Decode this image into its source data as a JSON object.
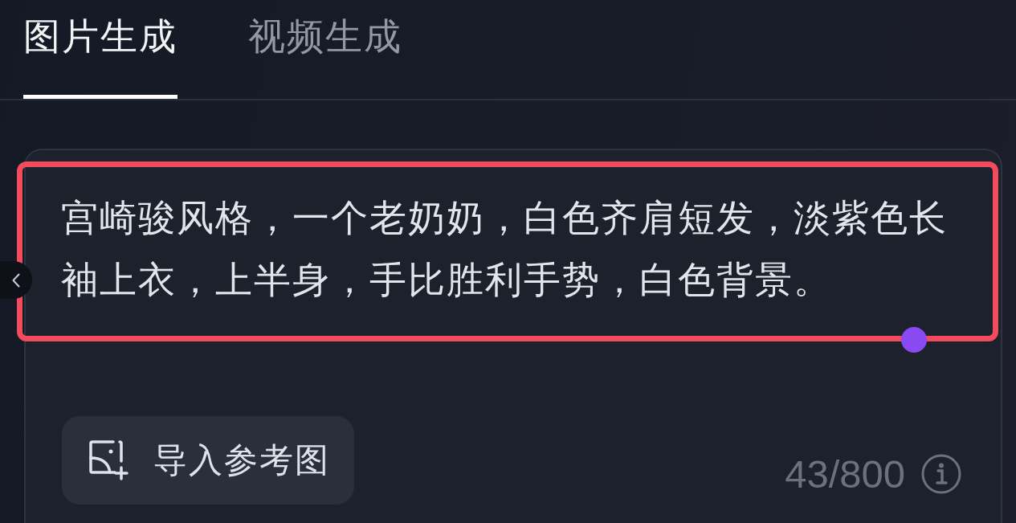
{
  "tabs": [
    {
      "label": "图片生成",
      "selected": true
    },
    {
      "label": "视频生成",
      "selected": false
    }
  ],
  "prompt": {
    "value": "宫崎骏风格，一个老奶奶，白色齐肩短发，淡紫色长袖上衣，上半身，手比胜利手势，白色背景。",
    "highlighted": true
  },
  "reference_button": {
    "label": "导入参考图"
  },
  "char_count": "43/800"
}
